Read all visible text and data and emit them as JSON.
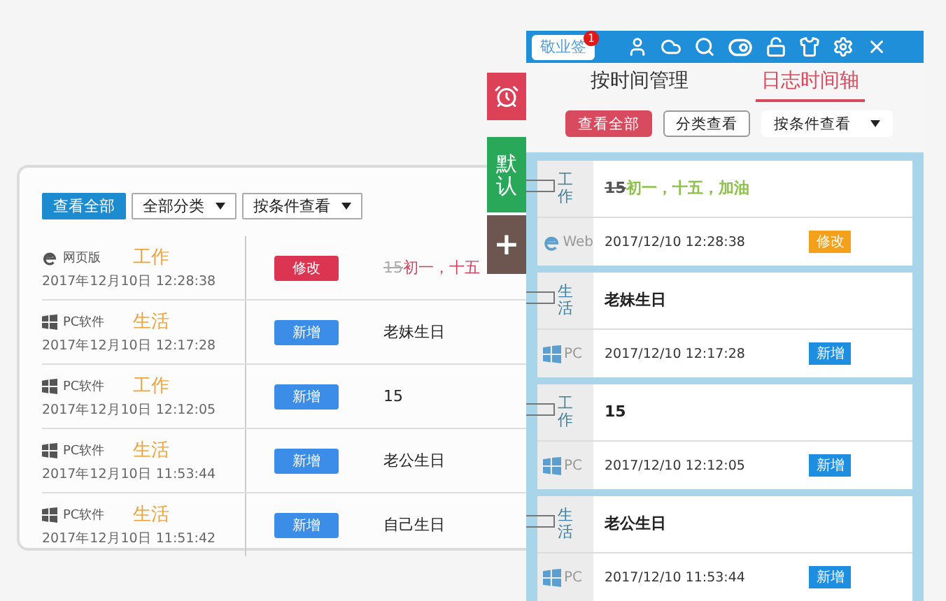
{
  "left_panel": {
    "filters": [
      {
        "kind": "button",
        "label": "查看全部"
      },
      {
        "kind": "select",
        "label": "全部分类"
      },
      {
        "kind": "select",
        "label": "按条件查看"
      }
    ],
    "rows": [
      {
        "kind": "web",
        "source": "网页版",
        "category": "工作",
        "time": "2017年12月10日 12:28:38",
        "action": {
          "kind": "edit",
          "label": "修改"
        },
        "old_note": "15",
        "note": "初一，十五"
      },
      {
        "kind": "pc",
        "source": "PC软件",
        "category": "生活",
        "time": "2017年12月10日 12:17:28",
        "action": {
          "kind": "add",
          "label": "新增"
        },
        "note": "老妹生日"
      },
      {
        "kind": "pc",
        "source": "PC软件",
        "category": "工作",
        "time": "2017年12月10日 12:12:05",
        "action": {
          "kind": "add",
          "label": "新增"
        },
        "note": "15"
      },
      {
        "kind": "pc",
        "source": "PC软件",
        "category": "生活",
        "time": "2017年12月10日 11:53:44",
        "action": {
          "kind": "add",
          "label": "新增"
        },
        "note": "老公生日"
      },
      {
        "kind": "pc",
        "source": "PC软件",
        "category": "生活",
        "time": "2017年12月10日 11:51:42",
        "action": {
          "kind": "add",
          "label": "新增"
        },
        "note": "自己生日"
      }
    ]
  },
  "side_tabs": [
    {
      "kind": "alarm"
    },
    {
      "kind": "text",
      "label": "默认"
    },
    {
      "kind": "add",
      "label": "+"
    }
  ],
  "app": {
    "logo": "敬业签",
    "badge": "1",
    "tabs": [
      {
        "label": "按时间管理",
        "selected": false
      },
      {
        "label": "日志时间轴",
        "selected": true
      }
    ],
    "filters": [
      {
        "kind": "primary",
        "label": "查看全部"
      },
      {
        "kind": "outline",
        "label": "分类查看"
      },
      {
        "kind": "select",
        "label": "按条件查看"
      }
    ],
    "cards": [
      {
        "category": "工作",
        "kind": "web",
        "source": "Web",
        "old_note": "15",
        "note": "初一，十五，加油",
        "time": "2017/12/10 12:28:38",
        "action": {
          "kind": "edit",
          "label": "修改"
        }
      },
      {
        "category": "生活",
        "kind": "pc",
        "source": "PC",
        "note": "老妹生日",
        "time": "2017/12/10 12:17:28",
        "action": {
          "kind": "add",
          "label": "新增"
        }
      },
      {
        "category": "工作",
        "kind": "pc",
        "source": "PC",
        "note": "15",
        "time": "2017/12/10 12:12:05",
        "action": {
          "kind": "add",
          "label": "新增"
        }
      },
      {
        "category": "生活",
        "kind": "pc",
        "source": "PC",
        "note": "老公生日",
        "time": "2017/12/10 11:53:44",
        "action": {
          "kind": "add",
          "label": "新增"
        }
      }
    ]
  }
}
